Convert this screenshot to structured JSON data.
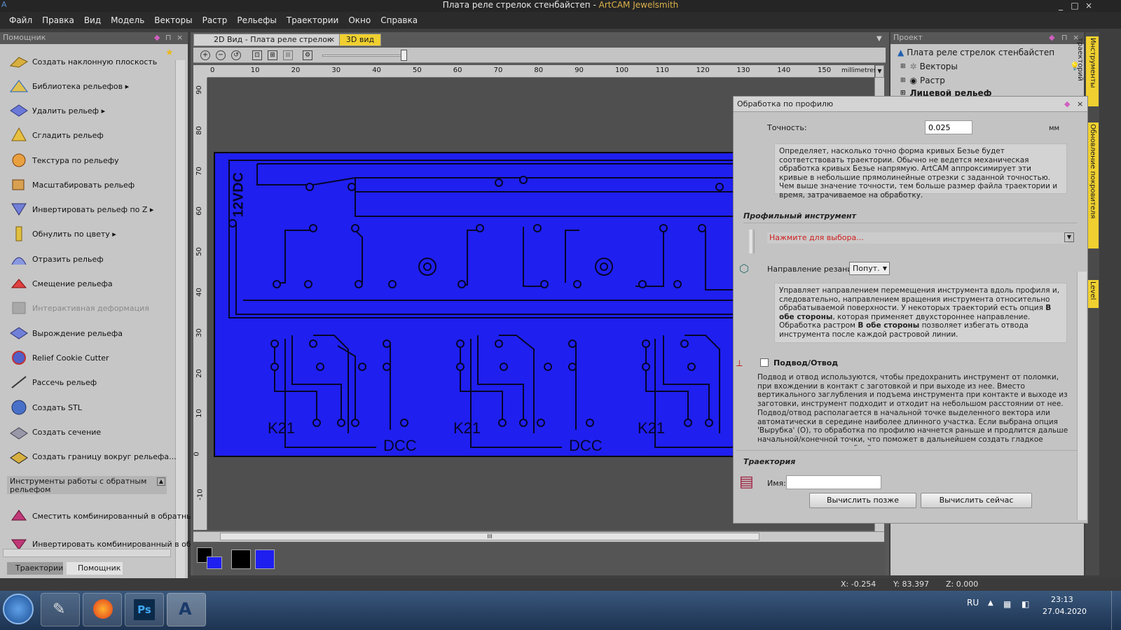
{
  "window": {
    "title": "Плата реле стрелок стенбайстеп - ",
    "app_name": "ArtCAM Jewelsmith",
    "min": "_",
    "max": "□",
    "close": "×"
  },
  "menu": [
    "Файл",
    "Правка",
    "Вид",
    "Модель",
    "Векторы",
    "Растр",
    "Рельефы",
    "Траектории",
    "Окно",
    "Справка"
  ],
  "left_panel": {
    "title": "Помощник",
    "pin": "⊓",
    "close": "×",
    "items": [
      {
        "label": "Создать наклонную плоскость",
        "arrow": ""
      },
      {
        "label": "Библиотека рельефов",
        "arrow": "▸"
      },
      {
        "label": "Удалить рельеф",
        "arrow": "▸"
      },
      {
        "label": "Сгладить рельеф",
        "arrow": ""
      },
      {
        "label": "Текстура по рельефу",
        "arrow": ""
      },
      {
        "label": "Масштабировать рельеф",
        "arrow": ""
      },
      {
        "label": "Инвертировать рельеф по Z",
        "arrow": "▸"
      },
      {
        "label": "Обнулить по цвету",
        "arrow": "▸"
      },
      {
        "label": "Отразить рельеф",
        "arrow": ""
      },
      {
        "label": "Смещение рельефа",
        "arrow": ""
      },
      {
        "label": "Интерактивная деформация",
        "arrow": ""
      },
      {
        "label": "Вырождение рельефа",
        "arrow": ""
      },
      {
        "label": "Relief Cookie Cutter",
        "arrow": ""
      },
      {
        "label": "Рассечь рельеф",
        "arrow": ""
      },
      {
        "label": "Создать STL",
        "arrow": ""
      },
      {
        "label": "Создать сечение",
        "arrow": ""
      },
      {
        "label": "Создать границу вокруг рельефа...",
        "arrow": ""
      }
    ],
    "group_title": "Инструменты работы с обратным рельефом",
    "group_items": [
      "Сместить комбинированный в обратный",
      "Инвертировать комбинированный в обр..."
    ],
    "tabs": [
      "Траектории",
      "Помощник"
    ]
  },
  "doc_tabs": [
    "2D Вид - Плата реле стрелок",
    "3D вид"
  ],
  "ruler": {
    "unit": "millimetres",
    "top": [
      "0",
      "10",
      "20",
      "30",
      "40",
      "50",
      "60",
      "70",
      "80",
      "90",
      "100",
      "110",
      "120",
      "130",
      "140",
      "150"
    ],
    "left": [
      "90",
      "80",
      "70",
      "60",
      "50",
      "40",
      "30",
      "20",
      "10",
      "0",
      "-10"
    ]
  },
  "pcb": {
    "labels": [
      "12VDC",
      "K21",
      "DCC",
      "K21",
      "DCC",
      "K21"
    ]
  },
  "dialog": {
    "title": "Обработка по профилю",
    "precision_label": "Точность:",
    "precision_value": "0.025",
    "precision_unit": "мм",
    "precision_help": "Определяет, насколько точно форма кривых Безье будет соответствовать траектории. Обычно не ведется механическая обработка кривых Безье напрямую. ArtCAM аппроксимирует эти кривые в небольшие прямолинейные отрезки с заданной точностью. Чем выше значение точности, тем больше размер файла траектории и время, затрачиваемое на обработку.",
    "profile_tool_section": "Профильный инструмент",
    "tool_select": "Нажмите для выбора...",
    "cut_dir_label": "Направление резания:",
    "cut_dir_value": "Попут.",
    "cut_dir_help_1": "Управляет направлением перемещения инструмента вдоль профиля и, следовательно, направлением вращения инструмента относительно обрабатываемой поверхности. У некоторых траекторий есть опция ",
    "cut_dir_help_b1": "В обе стороны",
    "cut_dir_help_2": ", которая применяет двухстороннее направление. Обработка растром ",
    "cut_dir_help_b2": "В обе стороны",
    "cut_dir_help_3": " позволяет избегать отвода инструмента после каждой растровой линии.",
    "leadin_label": "Подвод/Отвод",
    "leadin_help": "Подвод и отвод используются, чтобы предохранить инструмент от поломки, при вхождении в контакт с заготовкой и при выходе из нее. Вместо вертикального заглубления и подъема инструмента при контакте и выходе из заготовки, инструмент подходит и отходит на небольшом расстоянии от нее. Подвод/отвод располагается в начальной точке выделенного вектора или автоматически в середине наиболее длинного участка. Если выбрана опция 'Вырубка' (O), то обработка по профилю начнется раньше и продлится дальше начальной/конечной точки, что поможет в дальнейшем создать гладкое окончание траектории обработки.",
    "toolpath_section": "Траектория",
    "name_label": "Имя:",
    "name_value": "",
    "btn_later": "Вычислить позже",
    "btn_now": "Вычислить сейчас"
  },
  "project": {
    "title": "Проект",
    "root": "Плата реле стрелок стенбайстеп",
    "items": [
      "Векторы",
      "Растр",
      "Лицевой рельеф"
    ]
  },
  "side_tabs": [
    "Инструменты траекторий",
    "Обновление покровителя",
    "Level"
  ],
  "status": {
    "x": "X: -0.254",
    "y": "Y: 83.397",
    "z": "Z: 0.000"
  },
  "taskbar": {
    "lang": "RU",
    "time": "23:13",
    "date": "27.04.2020"
  },
  "colors": {
    "pcb": "#1f1ff0",
    "palette_black": "#000000",
    "palette_blue": "#1f1ff0"
  }
}
